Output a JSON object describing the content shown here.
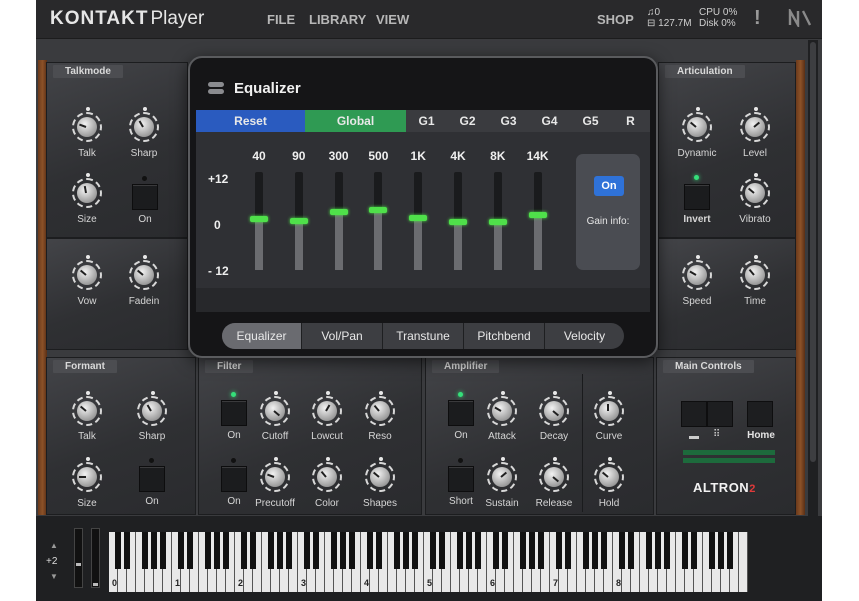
{
  "header": {
    "logo_main": "KONTAKT",
    "logo_sub": "Player",
    "menu": [
      "FILE",
      "LIBRARY",
      "VIEW"
    ],
    "shop": "SHOP",
    "voices": "0",
    "memory": "127.7M",
    "cpu_label": "CPU",
    "cpu_value": "0%",
    "disk_label": "Disk",
    "disk_value": "0%",
    "warning": "!"
  },
  "panels": {
    "talkmode": {
      "title": "Talkmode",
      "knobs": [
        "Talk",
        "Sharp",
        "Size",
        "Vow",
        "Fadein"
      ],
      "button_label": "On"
    },
    "articulation": {
      "title": "Articulation",
      "labels": [
        "Dynamic",
        "Level",
        "Invert",
        "Vibrato",
        "Speed",
        "Time"
      ]
    },
    "formant": {
      "title": "Formant",
      "labels": [
        "Talk",
        "Sharp",
        "Size",
        "On"
      ]
    },
    "filter": {
      "title": "Filter",
      "labels": [
        "On",
        "Cutoff",
        "Lowcut",
        "Reso",
        "On",
        "Precutoff",
        "Color",
        "Shapes"
      ]
    },
    "amplifier": {
      "title": "Amplifier",
      "labels": [
        "On",
        "Attack",
        "Decay",
        "Curve",
        "Short",
        "Sustain",
        "Release",
        "Hold"
      ]
    },
    "main_controls": {
      "title": "Main Controls",
      "home_label": "Home",
      "brand": "ALTRON",
      "brand_version": "2"
    }
  },
  "equalizer": {
    "title": "Equalizer",
    "tabs": [
      "Reset",
      "Global",
      "G1",
      "G2",
      "G3",
      "G4",
      "G5",
      "R"
    ],
    "tab_colors": {
      "reset": "#2a5bbf",
      "global": "#2f9a53"
    },
    "frequencies": [
      "40",
      "90",
      "300",
      "500",
      "1K",
      "4K",
      "8K",
      "14K"
    ],
    "db_labels": [
      "+12",
      "0",
      "- 12"
    ],
    "band_gains_db": [
      0.6,
      0,
      2.2,
      2.8,
      0.8,
      -0.2,
      -0.3,
      1.4
    ],
    "on_button": "On",
    "gain_info": "Gain info:",
    "bottom_tabs": [
      "Equalizer",
      "Vol/Pan",
      "Transtune",
      "Pitchbend",
      "Velocity"
    ],
    "selected_bottom_tab": "Equalizer"
  },
  "keyboard": {
    "transpose": "+2",
    "octave_labels": [
      "0",
      "1",
      "2",
      "3",
      "4",
      "5",
      "6",
      "7",
      "8"
    ]
  }
}
